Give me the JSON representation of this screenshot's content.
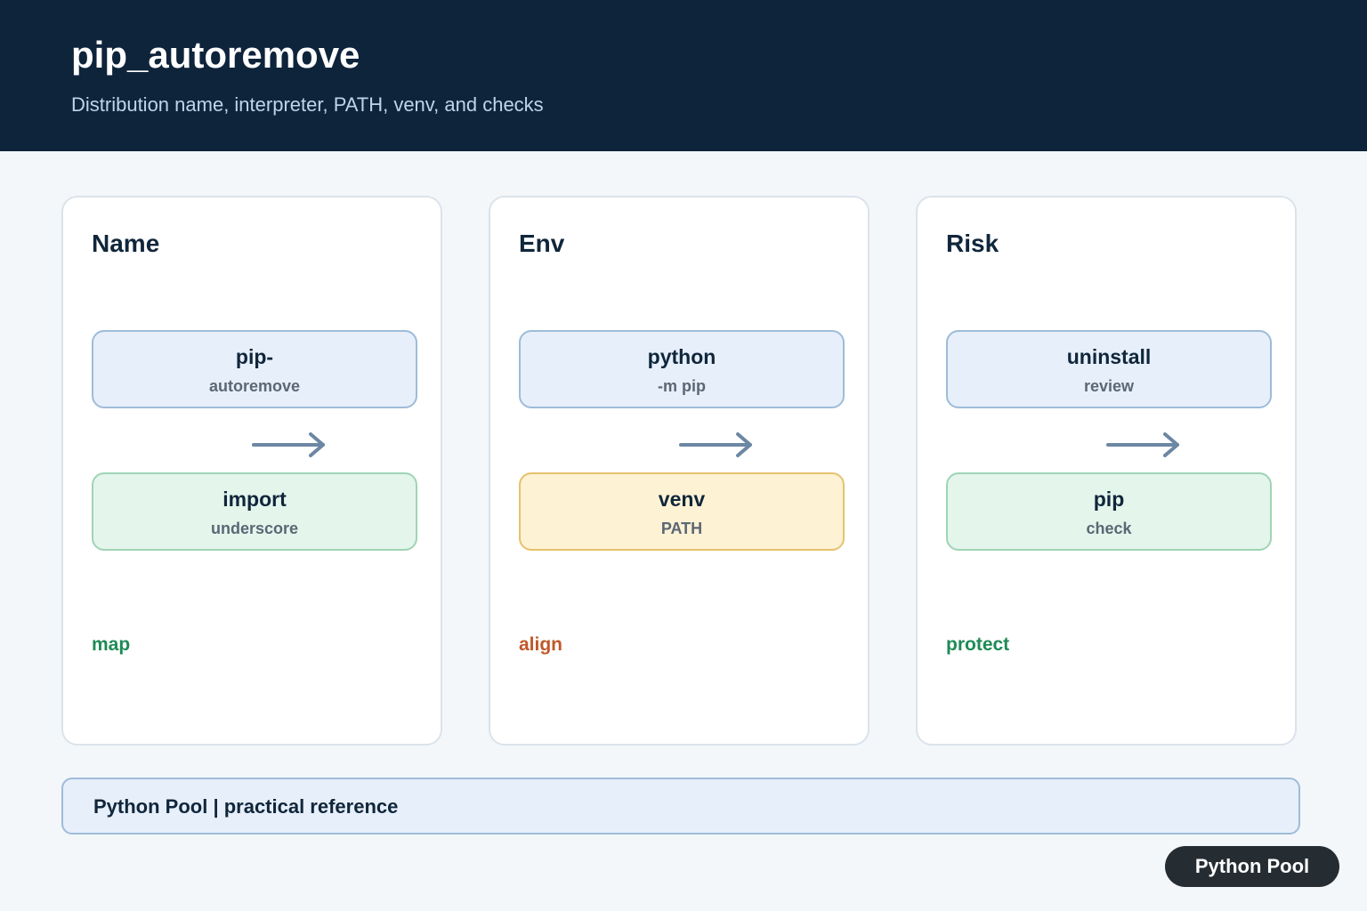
{
  "header": {
    "title": "pip_autoremove",
    "subtitle": "Distribution name, interpreter, PATH, venv, and checks"
  },
  "cards": [
    {
      "title": "Name",
      "top_node": {
        "main": "pip-",
        "sub": "autoremove"
      },
      "bottom_node": {
        "main": "import",
        "sub": "underscore"
      },
      "action": "map"
    },
    {
      "title": "Env",
      "top_node": {
        "main": "python",
        "sub": "-m pip"
      },
      "bottom_node": {
        "main": "venv",
        "sub": "PATH"
      },
      "action": "align"
    },
    {
      "title": "Risk",
      "top_node": {
        "main": "uninstall",
        "sub": "review"
      },
      "bottom_node": {
        "main": "pip",
        "sub": "check"
      },
      "action": "protect"
    }
  ],
  "footer": {
    "text": "Python Pool | practical reference"
  },
  "brand": {
    "label": "Python Pool"
  },
  "colors": {
    "header_bg": "#0e243b",
    "node_blue": "#e7effa",
    "node_green": "#e4f5ec",
    "node_yellow": "#fef2d4",
    "action_green": "#1e8a55",
    "action_orange": "#c0592a",
    "arrow": "#6b87a3"
  },
  "icons": {
    "arrow": "arrow-right-icon"
  }
}
